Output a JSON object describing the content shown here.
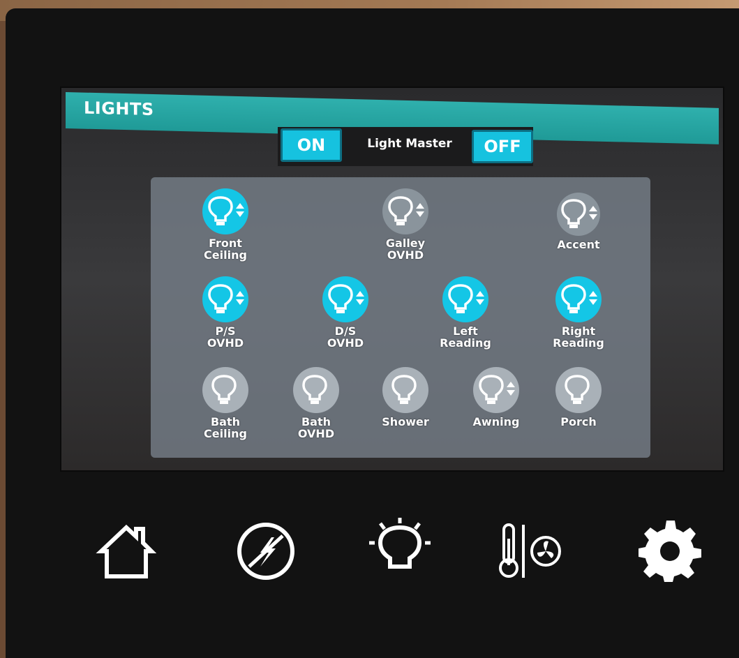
{
  "header": {
    "title": "LIGHTS"
  },
  "master": {
    "on_label": "ON",
    "label": "Light Master",
    "off_label": "OFF"
  },
  "lights": [
    {
      "label": "Front\nCeiling",
      "state": "on",
      "dimmable": true
    },
    {
      "label": "Galley\nOVHD",
      "state": "off",
      "dimmable": true
    },
    {
      "label": "Accent",
      "state": "off",
      "dimmable": true
    },
    {
      "label": "P/S\nOVHD",
      "state": "on",
      "dimmable": true
    },
    {
      "label": "D/S\nOVHD",
      "state": "on",
      "dimmable": true
    },
    {
      "label": "Left\nReading",
      "state": "on",
      "dimmable": true
    },
    {
      "label": "Right\nReading",
      "state": "on",
      "dimmable": true
    },
    {
      "label": "Bath\nCeiling",
      "state": "off",
      "dimmable": false
    },
    {
      "label": "Bath\nOVHD",
      "state": "off",
      "dimmable": false
    },
    {
      "label": "Shower",
      "state": "off",
      "dimmable": false
    },
    {
      "label": "Awning",
      "state": "off",
      "dimmable": true
    },
    {
      "label": "Porch",
      "state": "off",
      "dimmable": false
    }
  ],
  "nav": [
    {
      "icon": "home-icon"
    },
    {
      "icon": "power-icon"
    },
    {
      "icon": "lightbulb-icon"
    },
    {
      "icon": "climate-icon"
    },
    {
      "icon": "gear-icon"
    }
  ],
  "colors": {
    "accent": "#16c2df",
    "titlebar": "#2fb0ad",
    "light_on": "#14c6e6",
    "light_off": "#8a949c"
  }
}
